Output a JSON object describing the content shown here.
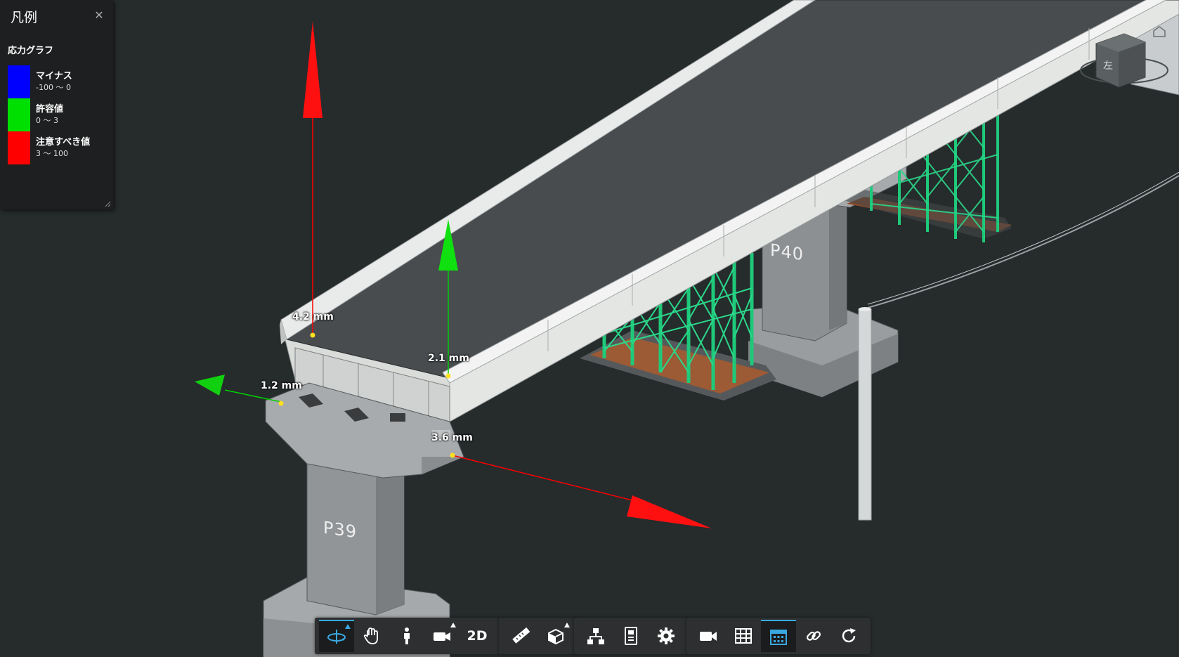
{
  "legend": {
    "title": "凡例",
    "subtitle": "応力グラフ",
    "items": [
      {
        "label": "マイナス",
        "range": "-100 ～ 0",
        "color": "#0000ff"
      },
      {
        "label": "許容値",
        "range": "0 ～ 3",
        "color": "#00e000"
      },
      {
        "label": "注意すべき値",
        "range": "3 ～ 100",
        "color": "#ff0000"
      }
    ]
  },
  "measurements": {
    "m1": "4.2 mm",
    "m2": "2.1 mm",
    "m3": "1.2 mm",
    "m4": "3.6 mm"
  },
  "piers": {
    "p39": "P39",
    "p40": "P40"
  },
  "viewcube": {
    "face_label": "左"
  },
  "toolbar": {
    "two_d_label": "2D",
    "groups": [
      [
        "orbit-icon",
        "pan-icon",
        "walk-icon",
        "camera-icon",
        "2d-button"
      ],
      [
        "measure-icon",
        "section-icon"
      ],
      [
        "model-tree-icon",
        "properties-icon",
        "settings-icon"
      ],
      [
        "video-icon",
        "table-icon",
        "calendar-icon",
        "link-icon",
        "refresh-icon"
      ]
    ]
  }
}
